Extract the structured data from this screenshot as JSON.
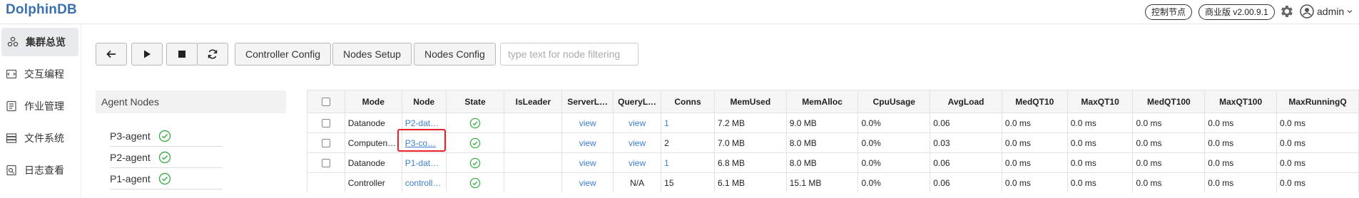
{
  "header": {
    "logo": "DolphinDB",
    "control_node_label": "控制节点",
    "version_label": "商业版 v2.00.9.1",
    "user_name": "admin",
    "icons": {
      "settings": "gear-icon",
      "user": "user-avatar-icon",
      "caret": "chevron-down-icon"
    }
  },
  "sidebar": {
    "items": [
      {
        "label": "集群总览",
        "icon": "cluster-icon",
        "active": true
      },
      {
        "label": "交互编程",
        "icon": "code-icon",
        "active": false
      },
      {
        "label": "作业管理",
        "icon": "job-icon",
        "active": false
      },
      {
        "label": "文件系统",
        "icon": "storage-icon",
        "active": false
      },
      {
        "label": "日志查看",
        "icon": "log-icon",
        "active": false
      }
    ]
  },
  "toolbar": {
    "icon_buttons": [
      "arrow-left-icon",
      "play-icon",
      "stop-icon",
      "refresh-icon"
    ],
    "controller_config": "Controller Config",
    "nodes_setup": "Nodes Setup",
    "nodes_config": "Nodes Config",
    "filter_placeholder": "type text for node filtering"
  },
  "agent_panel": {
    "title": "Agent Nodes",
    "agents": [
      {
        "name": "P3-agent",
        "status": "ok"
      },
      {
        "name": "P2-agent",
        "status": "ok"
      },
      {
        "name": "P1-agent",
        "status": "ok"
      }
    ]
  },
  "table": {
    "columns": [
      "",
      "Mode",
      "Node",
      "State",
      "IsLeader",
      "ServerL…",
      "QueryL…",
      "Conns",
      "MemUsed",
      "MemAlloc",
      "CpuUsage",
      "AvgLoad",
      "MedQT10",
      "MaxQT10",
      "MedQT100",
      "MaxQT100",
      "MaxRunningQ"
    ],
    "rows": [
      {
        "checkbox": true,
        "mode": "Datanode",
        "node": "P2-dat…",
        "state": "ok",
        "is_leader": "",
        "server_log": "view",
        "query_log": "view",
        "conns": "1",
        "conns_link": true,
        "mem_used": "7.2 MB",
        "mem_alloc": "9.0 MB",
        "cpu": "0.0%",
        "avg_load": "0.06",
        "med_qt10": "0.0 ms",
        "max_qt10": "0.0 ms",
        "med_qt100": "0.0 ms",
        "max_qt100": "0.0 ms",
        "max_running": "0.0 ms"
      },
      {
        "checkbox": true,
        "mode": "Computen…",
        "node": "P3-co…",
        "state": "ok",
        "is_leader": "",
        "server_log": "view",
        "query_log": "view",
        "conns": "2",
        "conns_link": false,
        "mem_used": "7.0 MB",
        "mem_alloc": "8.0 MB",
        "cpu": "0.0%",
        "avg_load": "0.03",
        "med_qt10": "0.0 ms",
        "max_qt10": "0.0 ms",
        "med_qt100": "0.0 ms",
        "max_qt100": "0.0 ms",
        "max_running": "0.0 ms"
      },
      {
        "checkbox": true,
        "mode": "Datanode",
        "node": "P1-dat…",
        "state": "ok",
        "is_leader": "",
        "server_log": "view",
        "query_log": "view",
        "conns": "1",
        "conns_link": true,
        "mem_used": "6.8 MB",
        "mem_alloc": "8.0 MB",
        "cpu": "0.0%",
        "avg_load": "0.06",
        "med_qt10": "0.0 ms",
        "max_qt10": "0.0 ms",
        "med_qt100": "0.0 ms",
        "max_qt100": "0.0 ms",
        "max_running": "0.0 ms"
      },
      {
        "checkbox": false,
        "mode": "Controller",
        "node": "controll…",
        "state": "ok",
        "is_leader": "",
        "server_log": "view",
        "query_log": "N/A",
        "conns": "15",
        "conns_link": false,
        "mem_used": "6.1 MB",
        "mem_alloc": "15.1 MB",
        "cpu": "0.0%",
        "avg_load": "0.06",
        "med_qt10": "0.0 ms",
        "max_qt10": "0.0 ms",
        "med_qt100": "0.0 ms",
        "max_qt100": "0.0 ms",
        "max_running": "0.0 ms"
      }
    ]
  },
  "colors": {
    "link": "#3b7fd0",
    "ok_green": "#3fae49",
    "highlight": "#e8202a",
    "logo": "#3a6fb0"
  }
}
